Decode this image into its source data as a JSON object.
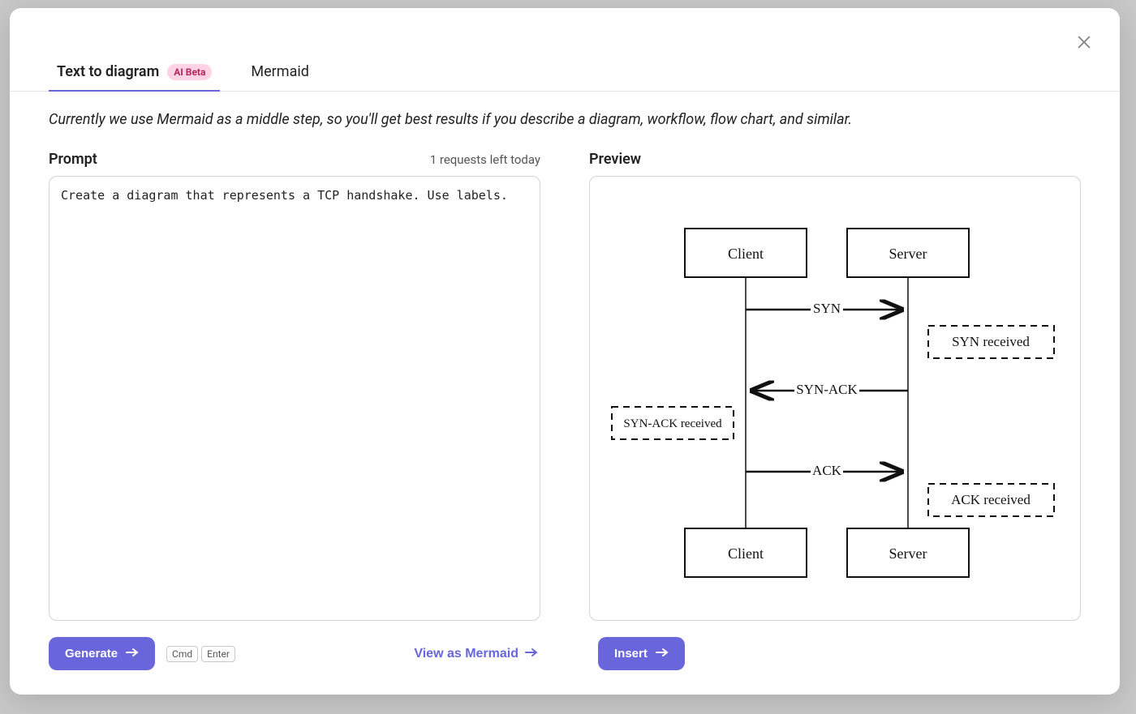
{
  "tabs": {
    "text_to_diagram": "Text to diagram",
    "badge": "AI Beta",
    "mermaid": "Mermaid"
  },
  "hint": "Currently we use Mermaid as a middle step, so you'll get best results if you describe a diagram, workflow, flow chart, and similar.",
  "prompt": {
    "label": "Prompt",
    "requests_left": "1 requests left today",
    "value": "Create a diagram that represents a TCP handshake. Use labels."
  },
  "preview": {
    "label": "Preview"
  },
  "diagram": {
    "client": "Client",
    "server": "Server",
    "syn": "SYN",
    "syn_received": "SYN received",
    "syn_ack": "SYN-ACK",
    "syn_ack_received": "SYN-ACK received",
    "ack": "ACK",
    "ack_received": "ACK received"
  },
  "actions": {
    "generate": "Generate",
    "kbd_cmd": "Cmd",
    "kbd_enter": "Enter",
    "view_as_mermaid": "View as Mermaid",
    "insert": "Insert"
  }
}
